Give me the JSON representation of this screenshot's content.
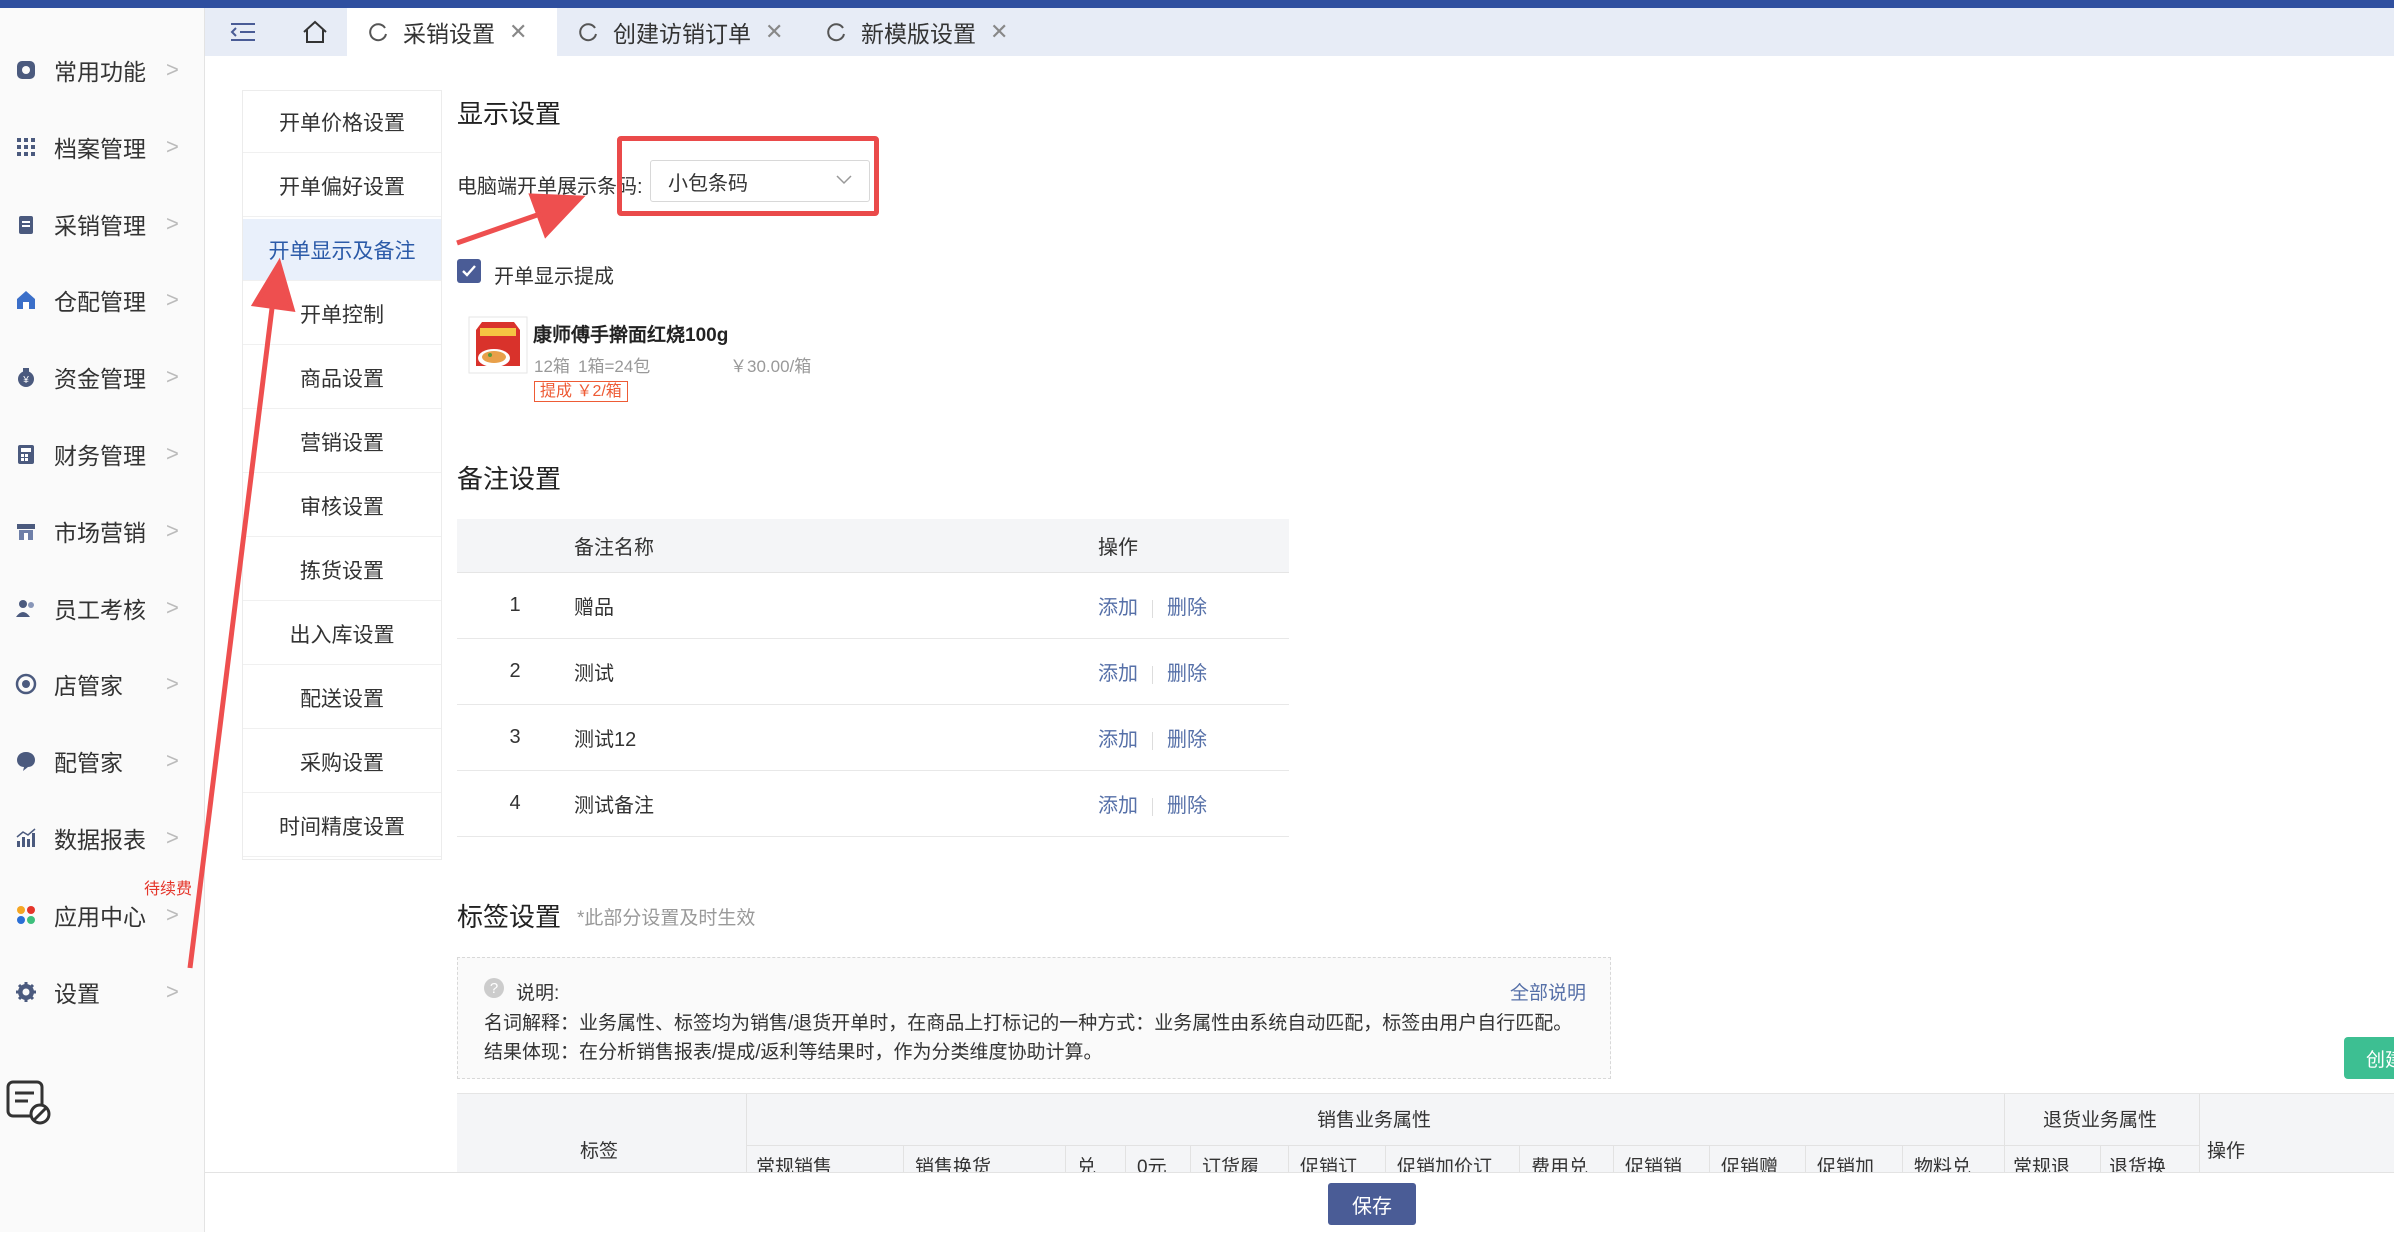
{
  "nav": {
    "items": [
      {
        "label": "常用功能",
        "icon": "target-icon"
      },
      {
        "label": "档案管理",
        "icon": "grid-icon"
      },
      {
        "label": "采销管理",
        "icon": "clipboard-icon"
      },
      {
        "label": "仓配管理",
        "icon": "warehouse-icon"
      },
      {
        "label": "资金管理",
        "icon": "money-bag-icon"
      },
      {
        "label": "财务管理",
        "icon": "calculator-icon"
      },
      {
        "label": "市场营销",
        "icon": "storefront-icon"
      },
      {
        "label": "员工考核",
        "icon": "people-icon"
      },
      {
        "label": "店管家",
        "icon": "store-manager-icon"
      },
      {
        "label": "配管家",
        "icon": "chat-bubble-icon"
      },
      {
        "label": "数据报表",
        "icon": "bar-chart-icon"
      },
      {
        "label": "应用中心",
        "icon": "apps-icon",
        "badge": "待续费"
      },
      {
        "label": "设置",
        "icon": "gear-icon"
      }
    ]
  },
  "tabs": [
    {
      "label": "采销设置",
      "active": true
    },
    {
      "label": "创建访销订单",
      "active": false
    },
    {
      "label": "新模版设置",
      "active": false
    }
  ],
  "subnav": [
    "开单价格设置",
    "开单偏好设置",
    "开单显示及备注",
    "开单控制",
    "商品设置",
    "营销设置",
    "审核设置",
    "拣货设置",
    "出入库设置",
    "配送设置",
    "采购设置",
    "时间精度设置"
  ],
  "display": {
    "title": "显示设置",
    "barcode_label": "电脑端开单展示条码:",
    "barcode_value": "小包条码",
    "show_commission_label": "开单显示提成",
    "show_commission_checked": true,
    "product": {
      "name": "康师傅手擀面红烧100g",
      "qty": "12箱",
      "unit": "1箱=24包",
      "price": "￥30.00/箱",
      "commission": "提成 ￥2/箱"
    }
  },
  "remarks": {
    "title": "备注设置",
    "col_name": "备注名称",
    "col_op": "操作",
    "add_label": "添加",
    "del_label": "删除",
    "rows": [
      {
        "no": "1",
        "name": "赠品"
      },
      {
        "no": "2",
        "name": "测试"
      },
      {
        "no": "3",
        "name": "测试12"
      },
      {
        "no": "4",
        "name": "测试备注"
      }
    ]
  },
  "tags": {
    "title": "标签设置",
    "subtitle": "*此部分设置及时生效",
    "notice_title": "说明:",
    "notice_link": "全部说明",
    "notice_line1": "名词解释：业务属性、标签均为销售/退货开单时，在商品上打标记的一种方式：业务属性由系统自动匹配，标签由用户自行匹配。",
    "notice_line2": "结果体现：在分析销售报表/提成/返利等结果时，作为分类维度协助计算。",
    "create_label": "创建",
    "table": {
      "col_tag": "标签",
      "group_sales": "销售业务属性",
      "group_return": "退货业务属性",
      "col_op": "操作",
      "sales_cols": [
        "常规销售",
        "销售换货",
        "兑",
        "0元",
        "订货履",
        "促销订",
        "促销加价订",
        "费用兑",
        "促销销",
        "促销赠",
        "促销加",
        "物料兑"
      ],
      "return_cols": [
        "常规退",
        "退货换"
      ]
    }
  },
  "footer": {
    "save_label": "保存"
  }
}
